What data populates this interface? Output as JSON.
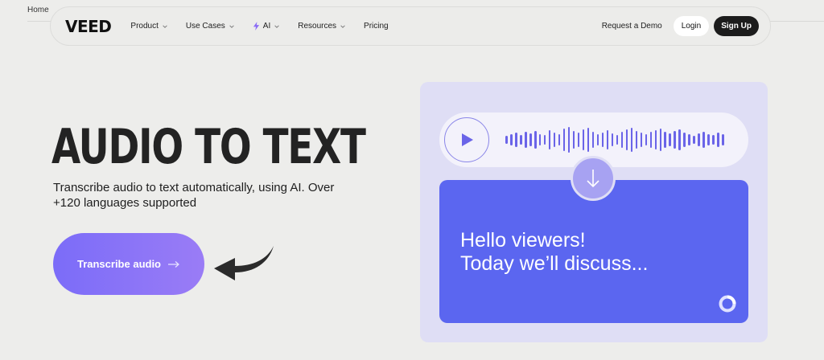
{
  "breadcrumb": {
    "label": "Home"
  },
  "nav": {
    "logo": "VEED",
    "items": [
      {
        "label": "Product",
        "has_chevron": true
      },
      {
        "label": "Use Cases",
        "has_chevron": true
      },
      {
        "label": "AI",
        "has_chevron": true,
        "icon": "bolt-icon"
      },
      {
        "label": "Resources",
        "has_chevron": true
      },
      {
        "label": "Pricing",
        "has_chevron": false
      }
    ],
    "request_demo": "Request a Demo",
    "login": "Login",
    "signup": "Sign Up"
  },
  "hero": {
    "title": "AUDIO TO TEXT",
    "subtitle": "Transcribe audio to text automatically, using AI. Over +120 languages supported",
    "cta_label": "Transcribe audio",
    "cta_icon": "arrow-right-icon",
    "pointer_icon": "curved-arrow-icon"
  },
  "illustration": {
    "play_icon": "play-icon",
    "down_icon": "arrow-down-icon",
    "transcript_line1": "Hello viewers!",
    "transcript_line2": "Today we’ll discuss...",
    "spinner_icon": "loading-ring-icon"
  },
  "colors": {
    "background": "#ededeb",
    "cta_start": "#7b6cf8",
    "cta_end": "#9a7cf6",
    "card_bg": "#dfdef5",
    "transcript_bg": "#5b66f0",
    "waveform": "#6a64e8",
    "signup_bg": "#1c1c1c"
  }
}
